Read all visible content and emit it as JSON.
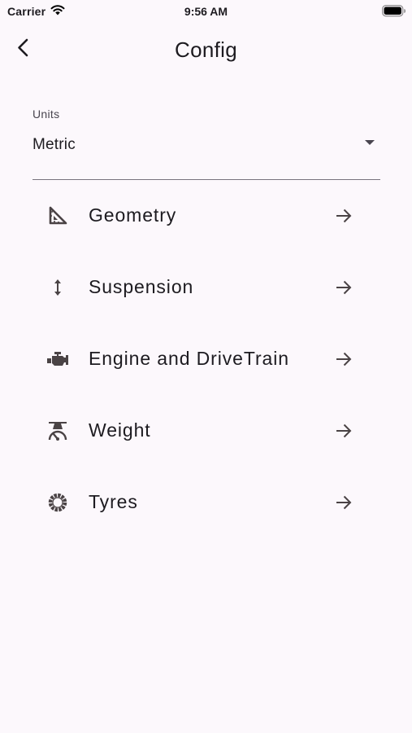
{
  "status_bar": {
    "carrier": "Carrier",
    "time": "9:56 AM",
    "icons": [
      "wifi-icon",
      "battery-icon"
    ]
  },
  "app_bar": {
    "title": "Config",
    "back_icon": "back-chevron-icon"
  },
  "units": {
    "label": "Units",
    "value": "Metric",
    "icon": "dropdown-arrow-icon"
  },
  "menu": {
    "items": [
      {
        "label": "Geometry",
        "icon": "set-square-icon"
      },
      {
        "label": "Suspension",
        "icon": "vertical-arrows-icon"
      },
      {
        "label": "Engine and DriveTrain",
        "icon": "engine-icon"
      },
      {
        "label": "Weight",
        "icon": "scale-icon"
      },
      {
        "label": "Tyres",
        "icon": "tyre-icon"
      }
    ],
    "trailing_icon": "arrow-forward-icon"
  },
  "colors": {
    "background": "#fcf8fc",
    "text": "#1d1b20",
    "icon": "#4a4345",
    "divider": "#79747e"
  }
}
